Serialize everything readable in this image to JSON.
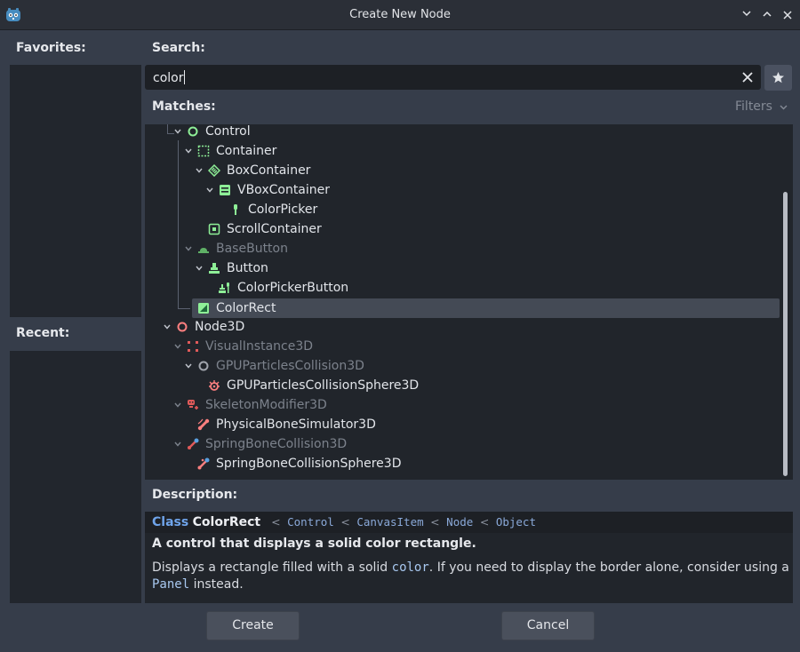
{
  "window": {
    "title": "Create New Node",
    "buttons": [
      "minimize-down",
      "maximize-up",
      "close"
    ]
  },
  "favorites": {
    "label": "Favorites:"
  },
  "recent": {
    "label": "Recent:"
  },
  "search": {
    "label": "Search:",
    "value": "color"
  },
  "matches": {
    "label": "Matches:",
    "filters_label": "Filters"
  },
  "tree": {
    "items": [
      {
        "label": "Control",
        "icon": "control-circle-icon",
        "color": "#8eef97",
        "dim": false
      },
      {
        "label": "Container",
        "icon": "container-icon",
        "color": "#8eef97",
        "dim": false
      },
      {
        "label": "BoxContainer",
        "icon": "box-container-icon",
        "color": "#8eef97",
        "dim": false
      },
      {
        "label": "VBoxContainer",
        "icon": "vbox-container-icon",
        "color": "#8eef97",
        "dim": false
      },
      {
        "label": "ColorPicker",
        "icon": "color-picker-icon",
        "color": "#8eef97",
        "dim": false
      },
      {
        "label": "ScrollContainer",
        "icon": "scroll-container-icon",
        "color": "#8eef97",
        "dim": false
      },
      {
        "label": "BaseButton",
        "icon": "base-button-icon",
        "color": "#8eef97",
        "dim": true
      },
      {
        "label": "Button",
        "icon": "button-icon",
        "color": "#8eef97",
        "dim": false
      },
      {
        "label": "ColorPickerButton",
        "icon": "color-picker-button-icon",
        "color": "#8eef97",
        "dim": false
      },
      {
        "label": "ColorRect",
        "icon": "color-rect-icon",
        "color": "#8eef97",
        "dim": false,
        "selected": true
      },
      {
        "label": "Node3D",
        "icon": "node3d-circle-icon",
        "color": "#fc7f7f",
        "dim": false
      },
      {
        "label": "VisualInstance3D",
        "icon": "visual-instance-icon",
        "color": "#fc7f7f",
        "dim": true
      },
      {
        "label": "GPUParticlesCollision3D",
        "icon": "particles-collision-icon",
        "color": "#b8bcc4",
        "dim": true
      },
      {
        "label": "GPUParticlesCollisionSphere3D",
        "icon": "particles-sphere-icon",
        "color": "#fc7f7f",
        "dim": false
      },
      {
        "label": "SkeletonModifier3D",
        "icon": "skeleton-modifier-icon",
        "color": "#fc7f7f",
        "dim": true
      },
      {
        "label": "PhysicalBoneSimulator3D",
        "icon": "bone-simulator-icon",
        "color": "#fc7f7f",
        "dim": false
      },
      {
        "label": "SpringBoneCollision3D",
        "icon": "spring-bone-icon",
        "color": "#fc7f7f",
        "dim": true
      },
      {
        "label": "SpringBoneCollisionSphere3D",
        "icon": "spring-bone-sphere-icon",
        "color": "#fc7f7f",
        "dim": false
      }
    ]
  },
  "description": {
    "label": "Description:",
    "keyword": "Class",
    "class_name": "ColorRect",
    "inheritance": [
      "Control",
      "CanvasItem",
      "Node",
      "Object"
    ],
    "separator": "<",
    "brief": "A control that displays a solid color rectangle.",
    "body_pre": "Displays a rectangle filled with a solid",
    "body_code1": "color",
    "body_mid": ". If you need to display the border alone, consider using a",
    "body_code2": "Panel",
    "body_post": "instead."
  },
  "actions": {
    "create_label": "Create",
    "cancel_label": "Cancel"
  },
  "colors": {
    "background": "#363d4a",
    "panel": "#21252b",
    "control_green": "#8eef97",
    "node3d_red": "#fc7f7f",
    "link_blue": "#6fa4ea"
  }
}
